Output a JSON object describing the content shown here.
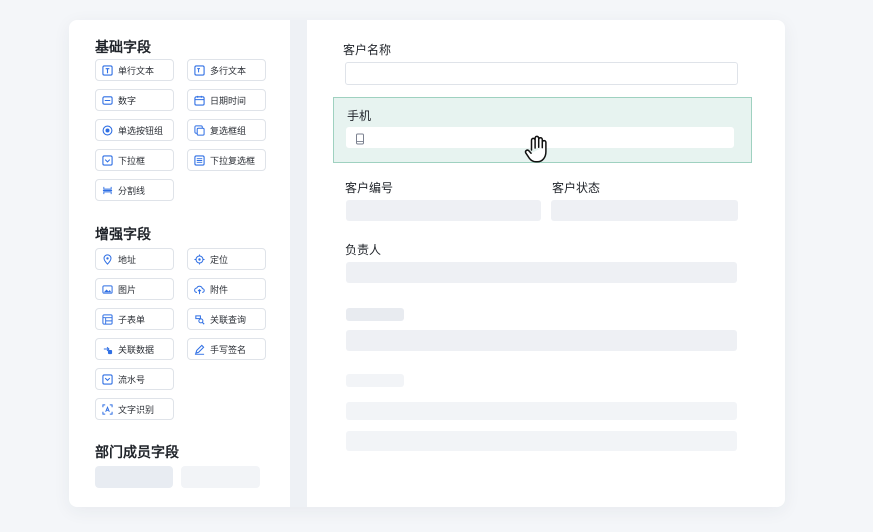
{
  "basic_fields": {
    "title": "基础字段",
    "items": [
      {
        "label": "单行文本",
        "icon": "text-field-icon"
      },
      {
        "label": "多行文本",
        "icon": "textarea-icon"
      },
      {
        "label": "数字",
        "icon": "number-icon"
      },
      {
        "label": "日期时间",
        "icon": "calendar-icon"
      },
      {
        "label": "单选按钮组",
        "icon": "radio-icon"
      },
      {
        "label": "复选框组",
        "icon": "checkbox-icon"
      },
      {
        "label": "下拉框",
        "icon": "dropdown-icon"
      },
      {
        "label": "下拉复选框",
        "icon": "multi-dropdown-icon"
      },
      {
        "label": "分割线",
        "icon": "divider-icon"
      }
    ]
  },
  "enhanced_fields": {
    "title": "增强字段",
    "items": [
      {
        "label": "地址",
        "icon": "map-pin-icon"
      },
      {
        "label": "定位",
        "icon": "locate-icon"
      },
      {
        "label": "图片",
        "icon": "image-icon"
      },
      {
        "label": "附件",
        "icon": "cloud-upload-icon"
      },
      {
        "label": "子表单",
        "icon": "subform-icon"
      },
      {
        "label": "关联查询",
        "icon": "link-query-icon"
      },
      {
        "label": "关联数据",
        "icon": "link-data-icon"
      },
      {
        "label": "手写签名",
        "icon": "pen-icon"
      },
      {
        "label": "流水号",
        "icon": "serial-icon"
      },
      {
        "label": "文字识别",
        "icon": "ocr-icon"
      }
    ]
  },
  "dept_fields": {
    "title": "部门成员字段"
  },
  "form": {
    "customer_name_label": "客户名称",
    "phone_label": "手机",
    "customer_no_label": "客户编号",
    "customer_status_label": "客户状态",
    "owner_label": "负责人"
  },
  "colors": {
    "accent": "#2f6fe4",
    "selected_bg": "#e7f3f0",
    "selected_border": "#9fd1c0"
  }
}
